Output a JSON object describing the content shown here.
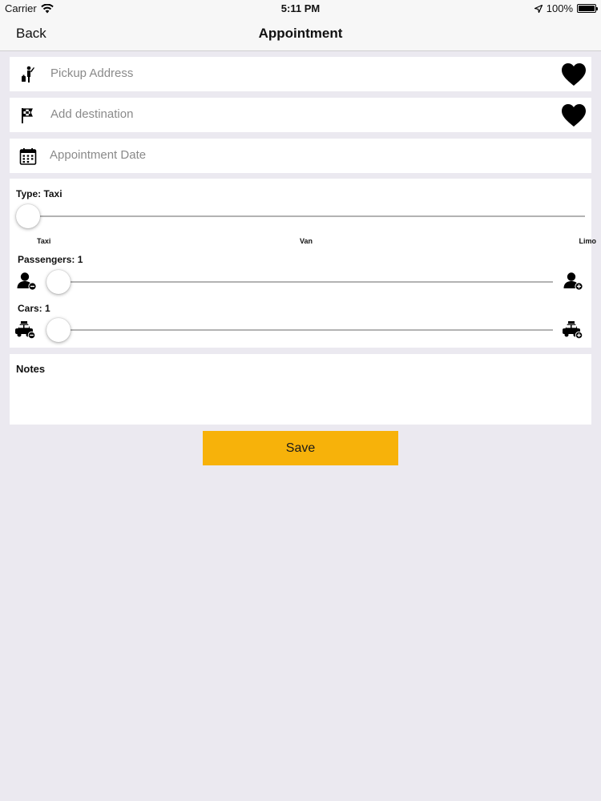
{
  "status_bar": {
    "carrier": "Carrier",
    "time": "5:11 PM",
    "battery": "100%"
  },
  "nav": {
    "back_label": "Back",
    "title": "Appointment"
  },
  "fields": {
    "pickup_placeholder": "Pickup Address",
    "destination_placeholder": "Add destination",
    "date_placeholder": "Appointment Date"
  },
  "type_slider": {
    "label": "Type: Taxi",
    "ticks": [
      "Taxi",
      "Van",
      "Limo"
    ],
    "value": "Taxi"
  },
  "passengers_slider": {
    "label": "Passengers: 1",
    "value": 1
  },
  "cars_slider": {
    "label": "Cars: 1",
    "value": 1
  },
  "notes": {
    "label": "Notes"
  },
  "save_label": "Save",
  "colors": {
    "accent": "#f7b20a",
    "background": "#ebe9f0"
  }
}
